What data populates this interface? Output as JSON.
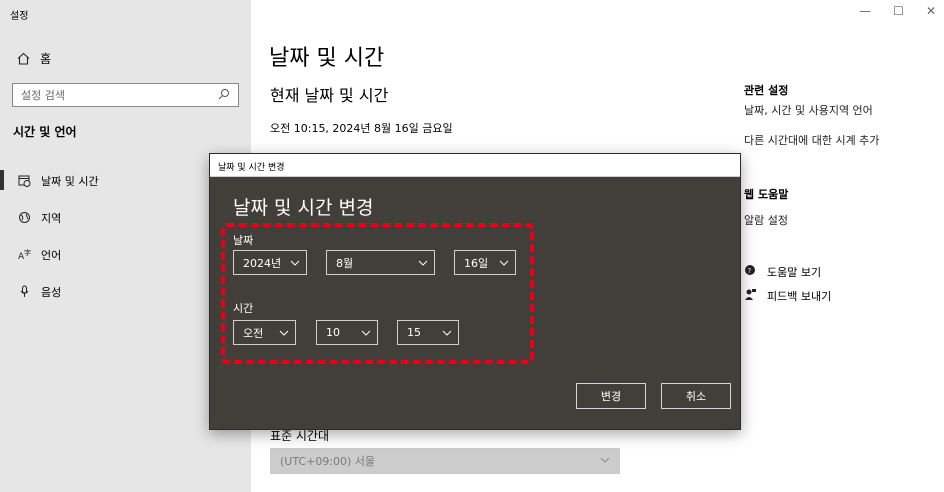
{
  "app": {
    "title": "설정"
  },
  "window_controls": {
    "minimize": "—",
    "maximize": "☐",
    "close": "✕"
  },
  "sidebar": {
    "home_label": "홈",
    "search_placeholder": "설정 검색",
    "section_title": "시간 및 언어",
    "items": [
      {
        "label": "날짜 및 시간",
        "icon": "calendar-clock-icon",
        "active": true
      },
      {
        "label": "지역",
        "icon": "globe-icon",
        "active": false
      },
      {
        "label": "언어",
        "icon": "language-icon",
        "active": false
      },
      {
        "label": "음성",
        "icon": "microphone-icon",
        "active": false
      }
    ]
  },
  "main": {
    "page_title": "날짜 및 시간",
    "sub_title": "현재 날짜 및 시간",
    "current_datetime": "오전 10:15, 2024년 8월 16일 금요일",
    "timezone_label": "표준 시간대",
    "timezone_value": "(UTC+09:00) 서울"
  },
  "right_panel": {
    "related_heading": "관련 설정",
    "related_links": [
      "날짜, 시간 및 사용지역 언어",
      "다른 시간대에 대한 시계 추가"
    ],
    "web_help_heading": "웹 도움말",
    "web_help_link": "알람 설정",
    "help_link": "도움말 보기",
    "feedback_link": "피드백 보내기"
  },
  "dialog": {
    "title": "날짜 및 시간 변경",
    "heading": "날짜 및 시간 변경",
    "date_label": "날짜",
    "year": "2024년",
    "month": "8월",
    "day": "16일",
    "time_label": "시간",
    "ampm": "오전",
    "hour": "10",
    "minute": "15",
    "change_button": "변경",
    "cancel_button": "취소",
    "highlight_color": "#e8001b"
  }
}
